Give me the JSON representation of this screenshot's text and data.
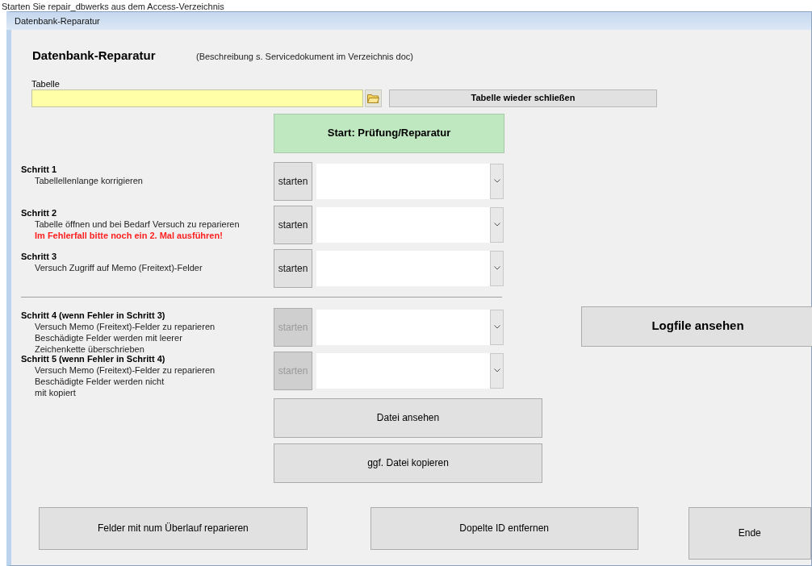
{
  "caption": "Starten Sie repair_dbwerks aus dem Access-Verzeichnis",
  "window": {
    "title": "Datenbank-Reparatur"
  },
  "heading": "Datenbank-Reparatur",
  "description": "(Beschreibung s. Servicedokument im Verzeichnis doc)",
  "table_field": {
    "label": "Tabelle",
    "close_button": "Tabelle wieder schließen"
  },
  "start_button": "Start: Prüfung/Reparatur",
  "steps": [
    {
      "title": "Schritt 1",
      "lines": [
        {
          "kind": "normal",
          "text": "Tabellellenlange korrigieren"
        }
      ],
      "button": "starten",
      "disabled": false
    },
    {
      "title": "Schritt 2",
      "lines": [
        {
          "kind": "normal",
          "text": "Tabelle öffnen und bei Bedarf Versuch zu reparieren"
        },
        {
          "kind": "warning",
          "text": "Im Fehlerfall bitte noch ein 2. Mal ausführen!"
        }
      ],
      "button": "starten",
      "disabled": false
    },
    {
      "title": "Schritt 3",
      "lines": [
        {
          "kind": "normal",
          "text": "Versuch Zugriff auf Memo (Freitext)-Felder"
        }
      ],
      "button": "starten",
      "disabled": false
    },
    {
      "title": "Schritt 4 (wenn Fehler in Schritt 3)",
      "lines": [
        {
          "kind": "normal",
          "text": "Versuch Memo (Freitext)-Felder zu reparieren"
        },
        {
          "kind": "normal",
          "text": "Beschädigte Felder werden mit leerer"
        },
        {
          "kind": "normal",
          "text": "Zeichenkette überschrieben"
        }
      ],
      "button": "starten",
      "disabled": true
    },
    {
      "title": "Schritt 5 (wenn Fehler in Schritt 4)",
      "lines": [
        {
          "kind": "normal",
          "text": "Versuch Memo (Freitext)-Felder zu reparieren"
        },
        {
          "kind": "normal",
          "text": "Beschädigte Felder werden nicht"
        },
        {
          "kind": "normal",
          "text": "mit kopiert"
        }
      ],
      "button": "starten",
      "disabled": true
    }
  ],
  "logfile_button": "Logfile ansehen",
  "file_buttons": [
    "Datei ansehen",
    "ggf. Datei kopieren"
  ],
  "bottom_buttons": [
    "Felder mit num Überlauf reparieren",
    "Dopelte ID entfernen",
    "Ende"
  ]
}
